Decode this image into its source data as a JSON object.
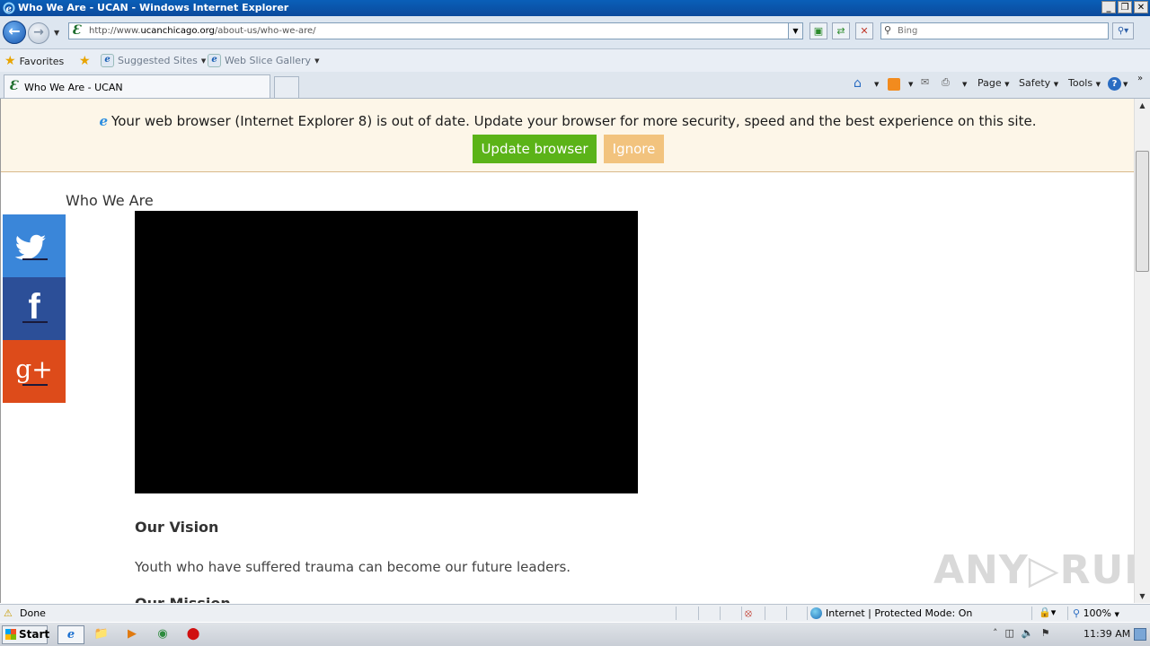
{
  "window": {
    "title": "Who We Are - UCAN - Windows Internet Explorer",
    "minimize": "_",
    "restore": "❐",
    "close": "✕"
  },
  "nav": {
    "address": {
      "prefix": "http://www.",
      "domain": "ucanchicago.org",
      "path": "/about-us/who-we-are/"
    },
    "search_placeholder": "Bing"
  },
  "favorites_bar": {
    "favorites": "Favorites",
    "suggested_sites": "Suggested Sites",
    "web_slice_gallery": "Web Slice Gallery"
  },
  "tabs": [
    {
      "label": "Who We Are - UCAN"
    }
  ],
  "command_bar": {
    "page": "Page",
    "safety": "Safety",
    "tools": "Tools"
  },
  "page": {
    "banner": {
      "message": "Your web browser (Internet Explorer 8) is out of date. Update your browser for more security, speed and the best experience on this site.",
      "update_label": "Update browser",
      "ignore_label": "Ignore"
    },
    "heading": "Who We Are",
    "vision_heading": "Our Vision",
    "vision_text": "Youth who have suffered trauma can become our future leaders.",
    "mission_heading": "Our Mission"
  },
  "watermark": "ANY▷RUN",
  "status": {
    "text": "Done",
    "zone": "Internet | Protected Mode: On",
    "zoom": "100%"
  },
  "taskbar": {
    "start": "Start",
    "clock": "11:39 AM"
  },
  "colors": {
    "update_button": "#5bb318",
    "ignore_button": "#f2c37e",
    "twitter": "#3a86d9",
    "facebook": "#2c4f98",
    "google_plus": "#dd4b1a"
  }
}
